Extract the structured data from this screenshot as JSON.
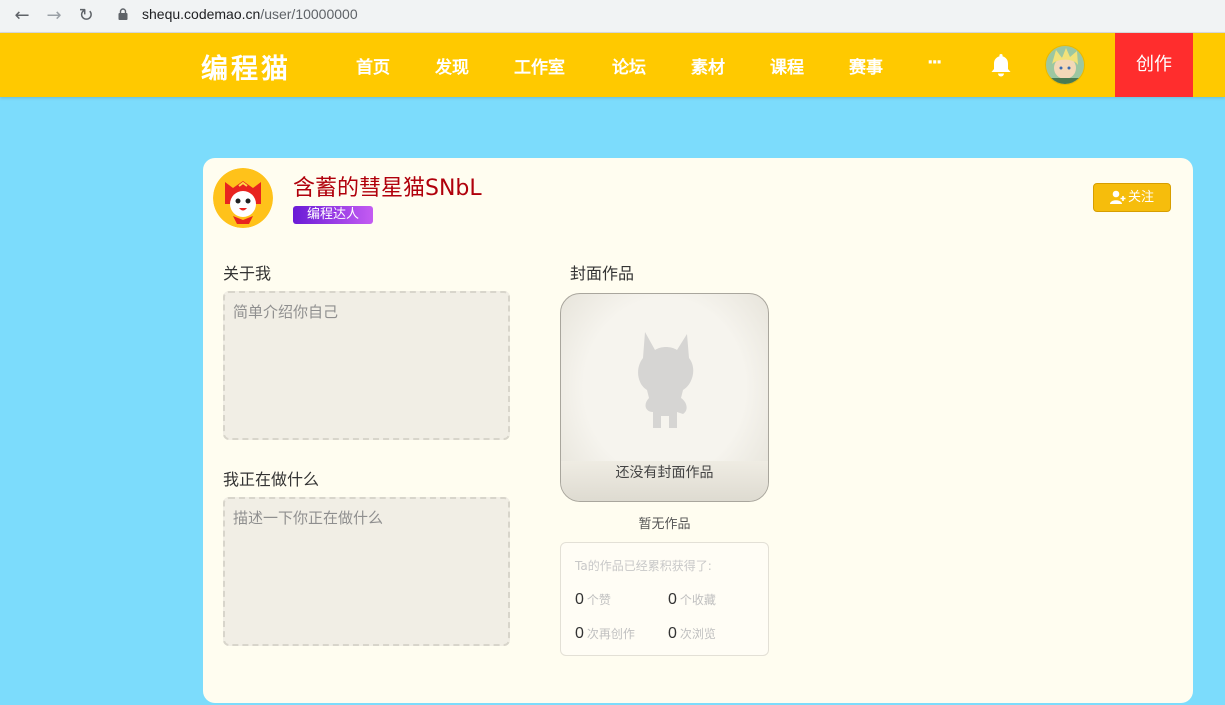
{
  "browser": {
    "url_domain": "shequ.codemao.cn",
    "url_path": "/user/10000000"
  },
  "header": {
    "logo": "编程猫",
    "nav": [
      "首页",
      "发现",
      "工作室",
      "论坛",
      "素材",
      "课程",
      "赛事",
      "···"
    ],
    "create_label": "创作"
  },
  "profile": {
    "nickname": "含蓄的彗星猫SNbL",
    "badge": "编程达人",
    "follow_label": "关注",
    "about_title": "关于我",
    "about_placeholder": "简单介绍你自己",
    "doing_title": "我正在做什么",
    "doing_placeholder": "描述一下你正在做什么",
    "cover_title": "封面作品",
    "cover_empty": "还没有封面作品",
    "no_works": "暂无作品",
    "stats_title": "Ta的作品已经累积获得了:",
    "stats": [
      {
        "value": "0",
        "label": "个赞"
      },
      {
        "value": "0",
        "label": "个收藏"
      },
      {
        "value": "0",
        "label": "次再创作"
      },
      {
        "value": "0",
        "label": "次浏览"
      }
    ]
  },
  "colors": {
    "header": "#ffc900",
    "page_bg": "#7cdcfc",
    "create": "#ff2d2d",
    "nickname": "#b0000b"
  }
}
